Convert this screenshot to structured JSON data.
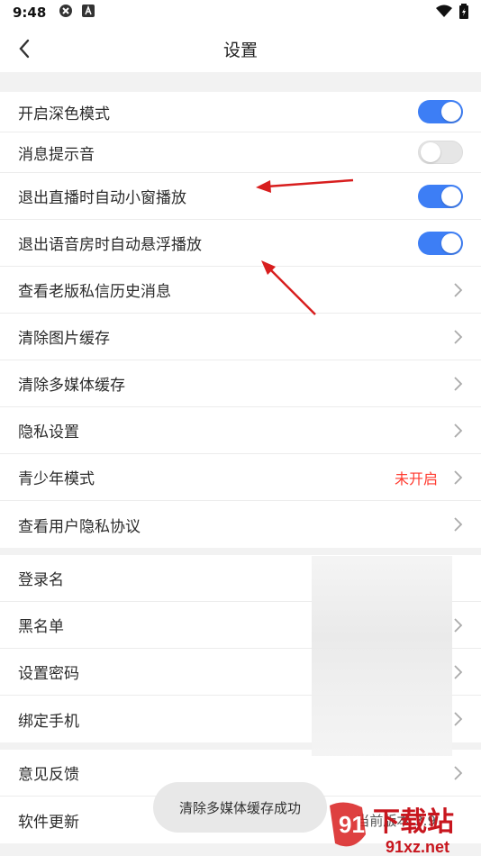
{
  "status": {
    "time": "9:48"
  },
  "header": {
    "title": "设置"
  },
  "section1": [
    {
      "label": "开启深色模式",
      "type": "toggle",
      "on": true
    },
    {
      "label": "消息提示音",
      "type": "toggle",
      "on": false
    },
    {
      "label": "退出直播时自动小窗播放",
      "type": "toggle",
      "on": true
    },
    {
      "label": "退出语音房时自动悬浮播放",
      "type": "toggle",
      "on": true
    },
    {
      "label": "查看老版私信历史消息",
      "type": "link"
    },
    {
      "label": "清除图片缓存",
      "type": "link"
    },
    {
      "label": "清除多媒体缓存",
      "type": "link"
    },
    {
      "label": "隐私设置",
      "type": "link"
    },
    {
      "label": "青少年模式",
      "type": "link",
      "value": "未开启"
    },
    {
      "label": "查看用户隐私协议",
      "type": "link"
    }
  ],
  "section2": [
    {
      "label": "登录名"
    },
    {
      "label": "黑名单"
    },
    {
      "label": "设置密码"
    },
    {
      "label": "绑定手机"
    }
  ],
  "section3": [
    {
      "label": "意见反馈"
    },
    {
      "label": "软件更新",
      "value": "当前版本 3.9"
    }
  ],
  "toast": {
    "text": "清除多媒体缓存成功"
  },
  "watermark": {
    "brand": "下载站",
    "site": "91xz.net"
  },
  "colors": {
    "accent": "#3d7ef5",
    "warning": "#ff3b30",
    "arrow": "#d81e1e"
  }
}
